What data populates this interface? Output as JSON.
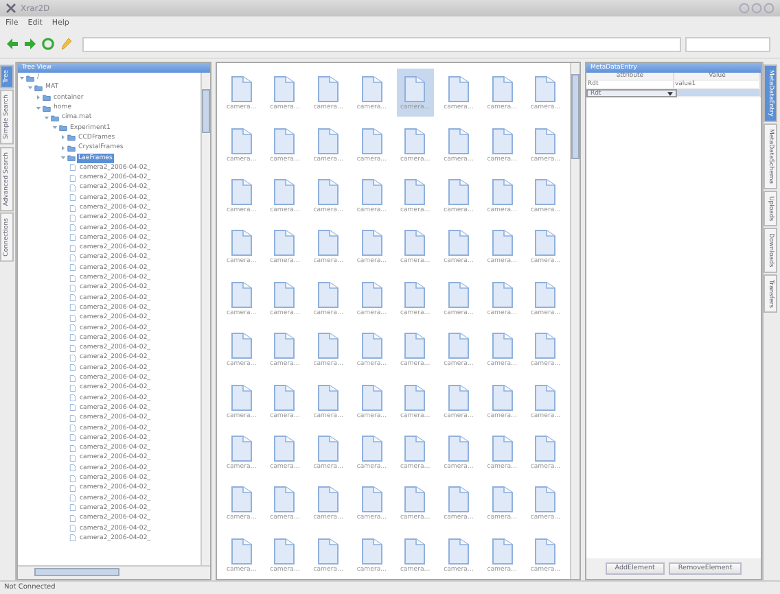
{
  "window": {
    "title": "Xrar2D"
  },
  "menu": [
    "File",
    "Edit",
    "Help"
  ],
  "left_tabs": [
    {
      "label": "Tree",
      "selected": true
    },
    {
      "label": "Simple Search",
      "selected": false
    },
    {
      "label": "Advanced Search",
      "selected": false
    },
    {
      "label": "Connections",
      "selected": false
    }
  ],
  "tree": {
    "title": "Tree View",
    "nodes": [
      {
        "label": "/",
        "kind": "folder",
        "expanded": true,
        "selected": false,
        "children": [
          {
            "label": "MAT",
            "kind": "folder",
            "expanded": true,
            "selected": false,
            "children": [
              {
                "label": "container",
                "kind": "folder",
                "expanded": false,
                "selected": false
              },
              {
                "label": "home",
                "kind": "folder",
                "expanded": true,
                "selected": false,
                "children": [
                  {
                    "label": "cima.mat",
                    "kind": "folder",
                    "expanded": true,
                    "selected": false,
                    "children": [
                      {
                        "label": "Experiment1",
                        "kind": "folder",
                        "expanded": true,
                        "selected": false,
                        "children": [
                          {
                            "label": "CCDFrames",
                            "kind": "folder",
                            "expanded": false,
                            "selected": false
                          },
                          {
                            "label": "CrystalFrames",
                            "kind": "folder",
                            "expanded": false,
                            "selected": false
                          },
                          {
                            "label": "LaeFrames",
                            "kind": "folder",
                            "expanded": true,
                            "selected": true,
                            "children": [
                              {
                                "label": "camera2_2006-04-02_",
                                "kind": "file",
                                "selected": false
                              },
                              {
                                "label": "camera2_2006-04-02_",
                                "kind": "file",
                                "selected": false
                              },
                              {
                                "label": "camera2_2006-04-02_",
                                "kind": "file",
                                "selected": false
                              },
                              {
                                "label": "camera2_2006-04-02_",
                                "kind": "file",
                                "selected": false
                              },
                              {
                                "label": "camera2_2006-04-02_",
                                "kind": "file",
                                "selected": false
                              },
                              {
                                "label": "camera2_2006-04-02_",
                                "kind": "file",
                                "selected": false
                              },
                              {
                                "label": "camera2_2006-04-02_",
                                "kind": "file",
                                "selected": false
                              },
                              {
                                "label": "camera2_2006-04-02_",
                                "kind": "file",
                                "selected": false
                              },
                              {
                                "label": "camera2_2006-04-02_",
                                "kind": "file",
                                "selected": false
                              },
                              {
                                "label": "camera2_2006-04-02_",
                                "kind": "file",
                                "selected": false
                              },
                              {
                                "label": "camera2_2006-04-02_",
                                "kind": "file",
                                "selected": false
                              },
                              {
                                "label": "camera2_2006-04-02_",
                                "kind": "file",
                                "selected": false
                              },
                              {
                                "label": "camera2_2006-04-02_",
                                "kind": "file",
                                "selected": false
                              },
                              {
                                "label": "camera2_2006-04-02_",
                                "kind": "file",
                                "selected": false
                              },
                              {
                                "label": "camera2_2006-04-02_",
                                "kind": "file",
                                "selected": false
                              },
                              {
                                "label": "camera2_2006-04-02_",
                                "kind": "file",
                                "selected": false
                              },
                              {
                                "label": "camera2_2006-04-02_",
                                "kind": "file",
                                "selected": false
                              },
                              {
                                "label": "camera2_2006-04-02_",
                                "kind": "file",
                                "selected": false
                              },
                              {
                                "label": "camera2_2006-04-02_",
                                "kind": "file",
                                "selected": false
                              },
                              {
                                "label": "camera2_2006-04-02_",
                                "kind": "file",
                                "selected": false
                              },
                              {
                                "label": "camera2_2006-04-02_",
                                "kind": "file",
                                "selected": false
                              },
                              {
                                "label": "camera2_2006-04-02_",
                                "kind": "file",
                                "selected": false
                              },
                              {
                                "label": "camera2_2006-04-02_",
                                "kind": "file",
                                "selected": false
                              },
                              {
                                "label": "camera2_2006-04-02_",
                                "kind": "file",
                                "selected": false
                              },
                              {
                                "label": "camera2_2006-04-02_",
                                "kind": "file",
                                "selected": false
                              },
                              {
                                "label": "camera2_2006-04-02_",
                                "kind": "file",
                                "selected": false
                              },
                              {
                                "label": "camera2_2006-04-02_",
                                "kind": "file",
                                "selected": false
                              },
                              {
                                "label": "camera2_2006-04-02_",
                                "kind": "file",
                                "selected": false
                              },
                              {
                                "label": "camera2_2006-04-02_",
                                "kind": "file",
                                "selected": false
                              },
                              {
                                "label": "camera2_2006-04-02_",
                                "kind": "file",
                                "selected": false
                              },
                              {
                                "label": "camera2_2006-04-02_",
                                "kind": "file",
                                "selected": false
                              },
                              {
                                "label": "camera2_2006-04-02_",
                                "kind": "file",
                                "selected": false
                              },
                              {
                                "label": "camera2_2006-04-02_",
                                "kind": "file",
                                "selected": false
                              },
                              {
                                "label": "camera2_2006-04-02_",
                                "kind": "file",
                                "selected": false
                              },
                              {
                                "label": "camera2_2006-04-02_",
                                "kind": "file",
                                "selected": false
                              },
                              {
                                "label": "camera2_2006-04-02_",
                                "kind": "file",
                                "selected": false
                              },
                              {
                                "label": "camera2_2006-04-02_",
                                "kind": "file",
                                "selected": false
                              },
                              {
                                "label": "camera2_2006-04-02_",
                                "kind": "file",
                                "selected": false
                              }
                            ]
                          }
                        ]
                      }
                    ]
                  }
                ]
              }
            ]
          }
        ]
      }
    ]
  },
  "files": [
    {
      "label": "camera...",
      "selected": false
    },
    {
      "label": "camera...",
      "selected": false
    },
    {
      "label": "camera...",
      "selected": false
    },
    {
      "label": "camera...",
      "selected": false
    },
    {
      "label": "camera...",
      "selected": true
    },
    {
      "label": "camera...",
      "selected": false
    },
    {
      "label": "camera...",
      "selected": false
    },
    {
      "label": "camera...",
      "selected": false
    },
    {
      "label": "camera...",
      "selected": false
    },
    {
      "label": "camera...",
      "selected": false
    },
    {
      "label": "camera...",
      "selected": false
    },
    {
      "label": "camera...",
      "selected": false
    },
    {
      "label": "camera...",
      "selected": false
    },
    {
      "label": "camera...",
      "selected": false
    },
    {
      "label": "camera...",
      "selected": false
    },
    {
      "label": "camera...",
      "selected": false
    },
    {
      "label": "camera...",
      "selected": false
    },
    {
      "label": "camera...",
      "selected": false
    },
    {
      "label": "camera...",
      "selected": false
    },
    {
      "label": "camera...",
      "selected": false
    },
    {
      "label": "camera...",
      "selected": false
    },
    {
      "label": "camera...",
      "selected": false
    },
    {
      "label": "camera...",
      "selected": false
    },
    {
      "label": "camera...",
      "selected": false
    },
    {
      "label": "camera...",
      "selected": false
    },
    {
      "label": "camera...",
      "selected": false
    },
    {
      "label": "camera...",
      "selected": false
    },
    {
      "label": "camera...",
      "selected": false
    },
    {
      "label": "camera...",
      "selected": false
    },
    {
      "label": "camera...",
      "selected": false
    },
    {
      "label": "camera...",
      "selected": false
    },
    {
      "label": "camera...",
      "selected": false
    },
    {
      "label": "camera...",
      "selected": false
    },
    {
      "label": "camera...",
      "selected": false
    },
    {
      "label": "camera...",
      "selected": false
    },
    {
      "label": "camera...",
      "selected": false
    },
    {
      "label": "camera...",
      "selected": false
    },
    {
      "label": "camera...",
      "selected": false
    },
    {
      "label": "camera...",
      "selected": false
    },
    {
      "label": "camera...",
      "selected": false
    },
    {
      "label": "camera...",
      "selected": false
    },
    {
      "label": "camera...",
      "selected": false
    },
    {
      "label": "camera...",
      "selected": false
    },
    {
      "label": "camera...",
      "selected": false
    },
    {
      "label": "camera...",
      "selected": false
    },
    {
      "label": "camera...",
      "selected": false
    },
    {
      "label": "camera...",
      "selected": false
    },
    {
      "label": "camera...",
      "selected": false
    },
    {
      "label": "camera...",
      "selected": false
    },
    {
      "label": "camera...",
      "selected": false
    },
    {
      "label": "camera...",
      "selected": false
    },
    {
      "label": "camera...",
      "selected": false
    },
    {
      "label": "camera...",
      "selected": false
    },
    {
      "label": "camera...",
      "selected": false
    },
    {
      "label": "camera...",
      "selected": false
    },
    {
      "label": "camera...",
      "selected": false
    },
    {
      "label": "camera...",
      "selected": false
    },
    {
      "label": "camera...",
      "selected": false
    },
    {
      "label": "camera...",
      "selected": false
    },
    {
      "label": "camera...",
      "selected": false
    },
    {
      "label": "camera...",
      "selected": false
    },
    {
      "label": "camera...",
      "selected": false
    },
    {
      "label": "camera...",
      "selected": false
    },
    {
      "label": "camera...",
      "selected": false
    },
    {
      "label": "camera...",
      "selected": false
    },
    {
      "label": "camera...",
      "selected": false
    },
    {
      "label": "camera...",
      "selected": false
    },
    {
      "label": "camera...",
      "selected": false
    },
    {
      "label": "camera...",
      "selected": false
    },
    {
      "label": "camera...",
      "selected": false
    },
    {
      "label": "camera...",
      "selected": false
    },
    {
      "label": "camera...",
      "selected": false
    },
    {
      "label": "camera...",
      "selected": false
    },
    {
      "label": "camera...",
      "selected": false
    },
    {
      "label": "camera...",
      "selected": false
    },
    {
      "label": "camera...",
      "selected": false
    },
    {
      "label": "camera...",
      "selected": false
    },
    {
      "label": "camera...",
      "selected": false
    },
    {
      "label": "camera...",
      "selected": false
    },
    {
      "label": "camera...",
      "selected": false
    }
  ],
  "metadata": {
    "title": "MetaDataEntry",
    "columns": [
      "attribute",
      "Value"
    ],
    "rows": [
      {
        "cells": [
          "Rdt",
          "value1"
        ]
      }
    ],
    "editor": {
      "value": "Rdt"
    },
    "buttons": [
      "AddElement",
      "RemoveElement"
    ]
  },
  "right_tabs": [
    {
      "label": "MetaDataEntry",
      "selected": true
    },
    {
      "label": "MetaDataSchema",
      "selected": false
    },
    {
      "label": "Uploads",
      "selected": false
    },
    {
      "label": "Downloads",
      "selected": false
    },
    {
      "label": "Transfers",
      "selected": false
    }
  ],
  "status_bar": "Not Connected"
}
